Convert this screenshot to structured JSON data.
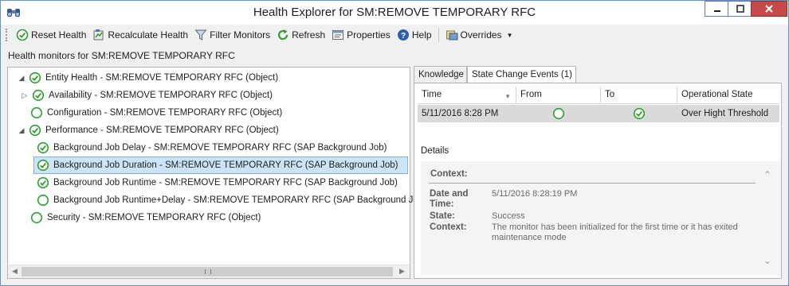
{
  "window": {
    "title": "Health Explorer for SM:REMOVE TEMPORARY RFC",
    "app_icon": "binoculars-icon"
  },
  "toolbar": {
    "reset_health": "Reset Health",
    "recalculate_health": "Recalculate Health",
    "filter_monitors": "Filter Monitors",
    "refresh": "Refresh",
    "properties": "Properties",
    "help": "Help",
    "overrides": "Overrides"
  },
  "subheader": "Health monitors for SM:REMOVE TEMPORARY RFC",
  "tree": [
    {
      "label": "Entity Health - SM:REMOVE TEMPORARY RFC (Object)",
      "state": "healthy",
      "expander": "expanded"
    },
    {
      "label": "Availability - SM:REMOVE TEMPORARY RFC (Object)",
      "state": "healthy",
      "expander": "collapsed"
    },
    {
      "label": "Configuration - SM:REMOVE TEMPORARY RFC (Object)",
      "state": "unmonitored",
      "expander": "none"
    },
    {
      "label": "Performance - SM:REMOVE TEMPORARY RFC (Object)",
      "state": "healthy",
      "expander": "expanded"
    },
    {
      "label": "Background Job Delay - SM:REMOVE TEMPORARY RFC (SAP Background Job)",
      "state": "healthy",
      "expander": "none"
    },
    {
      "label": "Background Job Duration - SM:REMOVE TEMPORARY RFC (SAP Background Job)",
      "state": "healthy",
      "expander": "none",
      "selected": true
    },
    {
      "label": "Background Job Runtime - SM:REMOVE TEMPORARY RFC (SAP Background Job)",
      "state": "healthy",
      "expander": "none"
    },
    {
      "label": "Background Job Runtime+Delay - SM:REMOVE TEMPORARY RFC (SAP Background Job)",
      "state": "unmonitored",
      "expander": "none"
    },
    {
      "label": "Security - SM:REMOVE TEMPORARY RFC (Object)",
      "state": "unmonitored",
      "expander": "none"
    }
  ],
  "tabs": [
    {
      "label": "Knowledge",
      "active": false
    },
    {
      "label": "State Change Events (1)",
      "active": true
    }
  ],
  "events_table": {
    "columns": [
      "Time",
      "From",
      "To",
      "Operational State"
    ],
    "rows": [
      {
        "time": "5/11/2016 8:28 PM",
        "from": "unmonitored",
        "to": "healthy",
        "operational_state": "Over Hight Threshold"
      }
    ]
  },
  "details": {
    "label": "Details",
    "context_title": "Context:",
    "fields": [
      {
        "key": "Date and Time:",
        "value": "5/11/2016 8:28:19 PM"
      },
      {
        "key": "State:",
        "value": "Success"
      },
      {
        "key": "Context:",
        "value": "The monitor has been initialized for the first time or it has exited maintenance mode"
      }
    ]
  },
  "colors": {
    "healthy": "#2e9e2e",
    "selection": "#cce4f7",
    "close_button": "#c74a4a"
  }
}
